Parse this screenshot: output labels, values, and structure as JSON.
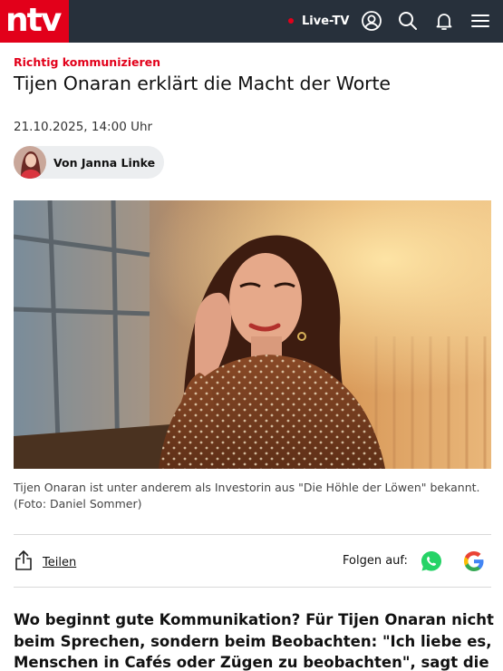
{
  "header": {
    "logo_text": "ntv",
    "live_label": "Live-TV",
    "icons": [
      "user-icon",
      "search-icon",
      "bell-icon",
      "menu-icon"
    ],
    "colors": {
      "bar": "#27303b",
      "brand": "#e2001a"
    }
  },
  "article": {
    "kicker": "Richtig kommunizieren",
    "headline": "Tijen Onaran erklärt die Macht der Worte",
    "date": "21.10.2025, 14:00 Uhr",
    "author": "Von Janna Linke",
    "caption": "Tijen Onaran ist unter anderem als Investorin aus \"Die Höhle der Löwen\" bekannt. (Foto: Daniel Sommer)",
    "lead": "Wo beginnt gute Kommunikation? Für Tijen Onaran nicht beim Sprechen, sondern beim Beobachten: \"Ich liebe es, Menschen in Cafés oder Zügen zu beobachten\", sagt die Investorin im ntv-"
  },
  "social": {
    "share_label": "Teilen",
    "follow_label": "Folgen auf:",
    "icons": [
      "whatsapp-icon",
      "google-icon"
    ]
  }
}
